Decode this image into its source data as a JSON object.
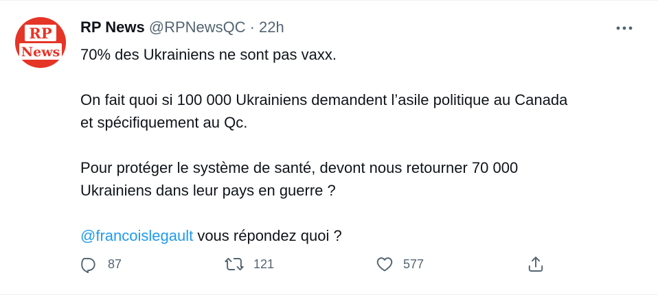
{
  "tweet": {
    "avatar_text_top": "RP",
    "avatar_text_bottom": "News",
    "display_name": "RP News",
    "handle": "@RPNewsQC",
    "separator": "·",
    "time": "22h",
    "lines": [
      "70% des Ukrainiens ne sont pas vaxx.",
      "On fait quoi si 100 000 Ukrainiens demandent l’asile politique au Canada",
      "et spécifiquement au Qc.",
      "Pour protéger le système de santé, devont nous retourner 70 000",
      "Ukrainiens dans leur pays en guerre ?"
    ],
    "mention": "@francoislegault",
    "mention_suffix": " vous répondez quoi ?"
  },
  "actions": {
    "reply_count": "87",
    "retweet_count": "121",
    "like_count": "577"
  },
  "icons": {
    "more": "more-horizontal-icon",
    "reply": "reply-icon",
    "retweet": "retweet-icon",
    "like": "heart-icon",
    "share": "share-icon"
  },
  "colors": {
    "avatar_bg": "#e53527",
    "mention": "#1d9bf0",
    "muted": "#536471",
    "text": "#0f1419"
  }
}
